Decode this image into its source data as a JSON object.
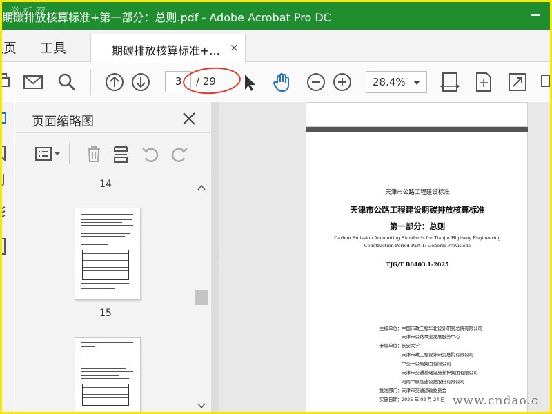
{
  "window": {
    "title": "期碳排放核算标准+第一部分：总则.pdf - Adobe Acrobat Pro DC",
    "watermark_top": "游 析 网"
  },
  "menu": {
    "home_label": "主页",
    "tools_label": "工具"
  },
  "tab": {
    "label": "期碳排放核算标准+...",
    "close": "×"
  },
  "toolbar": {
    "page_current": "3",
    "page_total": "/ 29",
    "zoom": "28.4%"
  },
  "thumbnails_panel": {
    "title": "页面缩略图",
    "pages": [
      "14",
      "15"
    ]
  },
  "document": {
    "header_small": "天津市公路工程建设标准",
    "title": "天津市公路工程建设期碳排放核算标准",
    "subtitle": "第一部分：总则",
    "english_line1": "Carbon Emission Accounting Standards for Tianjin Highway Engineering",
    "english_line2": "Construction Period Part 1: General Provisions",
    "code": "TJG/T B0403.1-2025",
    "orgs": [
      {
        "label": "主编单位：",
        "value": "中国市政工程华北设计研究总院有限公司"
      },
      {
        "label": "",
        "value": "天津市公路事业发展服务中心"
      },
      {
        "label": "参编单位：",
        "value": "长安大学"
      },
      {
        "label": "",
        "value": "天津市政工程设计研究总院有限公司"
      },
      {
        "label": "",
        "value": "中交一公局集团有限公司"
      },
      {
        "label": "",
        "value": "天津市交通基础设施养护集团有限公司"
      },
      {
        "label": "",
        "value": "河南中原高速公路股份有限公司"
      },
      {
        "label": "批准部门：",
        "value": "天津市交通运输委员会"
      },
      {
        "label": "实施日期：",
        "value": "2025 年 02 月 24 日"
      }
    ]
  },
  "watermark_bottom": "www.cndao.c",
  "colors": {
    "titlebar": "#1e8e2f",
    "frame": "#ffe600",
    "highlight_oval": "#e0352a",
    "doc_background": "#525659"
  }
}
